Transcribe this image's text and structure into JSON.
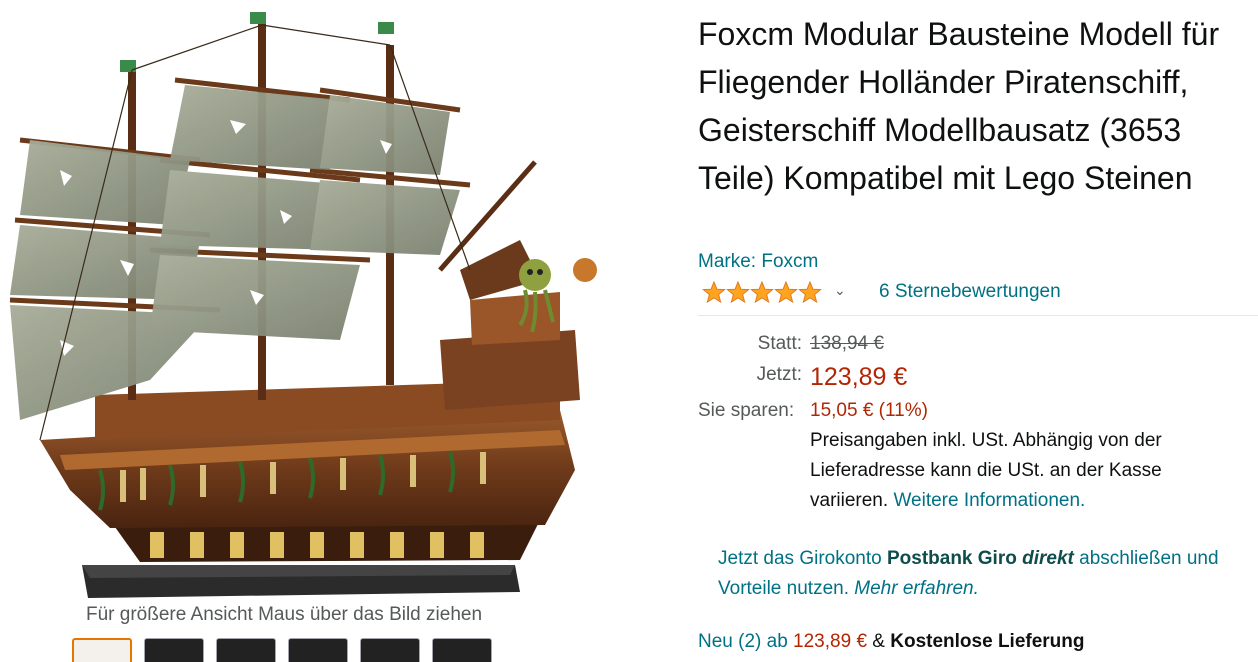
{
  "product": {
    "title": "Foxcm Modular Bausteine Modell für Fliegender Holländer Piratenschiff, Geisterschiff Modellbausatz (3653 Teile) Kompatibel mit Lego Steinen",
    "brand": "Marke: Foxcm",
    "rating": {
      "stars": 5,
      "reviews_link": "6 Sternebewertungen"
    }
  },
  "gallery": {
    "zoom_hint": "Für größere Ansicht Maus über das Bild ziehen",
    "thumbnails": 6,
    "selected_thumbnail": 1
  },
  "pricing": {
    "list_label": "Statt:",
    "list_price": "138,94 €",
    "current_label": "Jetzt:",
    "current_price": "123,89 €",
    "savings_label": "Sie sparen:",
    "savings_value": "15,05 € (11%)",
    "tax_note": "Preisangaben inkl. USt. Abhängig von der Lieferadresse kann die USt. an der Kasse variieren.",
    "tax_link": "Weitere Informationen."
  },
  "promo": {
    "text_a": "Jetzt das Girokonto ",
    "brand_bold": "Postbank Giro",
    "brand_italic": "direkt",
    "text_b": " abschließen und Vorteile nutzen. ",
    "link": "Mehr erfahren."
  },
  "offers": {
    "prefix": "Neu (2) ab ",
    "price": "123,89 €",
    "amp": " & ",
    "shipping": "Kostenlose Lieferung"
  },
  "colors": {
    "link": "#007185",
    "price": "#b12704",
    "star": "#ffa41c",
    "thumb_selected_border": "#e77600"
  }
}
